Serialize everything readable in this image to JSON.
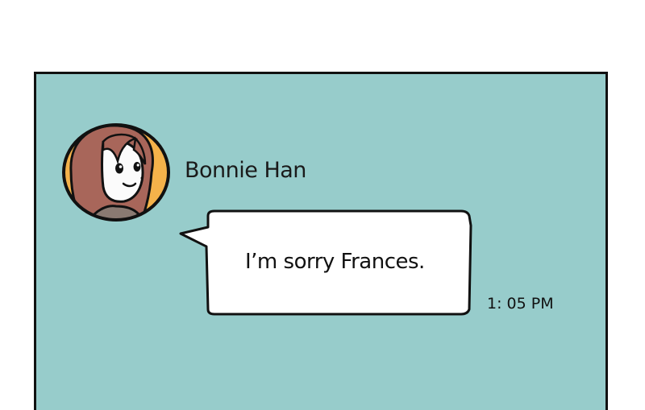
{
  "chat": {
    "sender_name": "Bonnie Han",
    "message_text": "I’m sorry Frances.",
    "timestamp": "1: 05 PM"
  },
  "colors": {
    "panel_background": "#97cccb",
    "bubble_background": "#ffffff",
    "avatar_ring": "#f4b24a",
    "hair": "#a8665a",
    "outline": "#111111"
  },
  "icons": {
    "avatar": "avatar-woman-brown-hair"
  }
}
